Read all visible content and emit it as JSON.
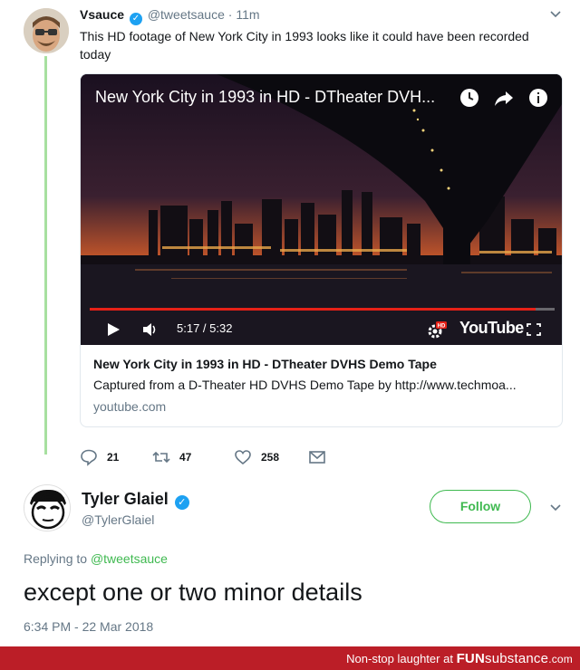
{
  "tweet1": {
    "name": "Vsauce",
    "handle": "@tweetsauce",
    "time": "· 11m",
    "text": "This HD footage of New York City in 1993 looks like it could have been recorded today",
    "video": {
      "title": "New York City in 1993 in HD - DTheater DVH...",
      "time": "5:17 / 5:32",
      "progress": 0.96,
      "logo": "YouTube",
      "hd_badge": "HD"
    },
    "card": {
      "title": "New York City in 1993 in HD - DTheater DVHS Demo Tape",
      "description": "Captured from a D-Theater HD DVHS Demo Tape by http://www.techmoa...",
      "domain": "youtube.com"
    },
    "actions": {
      "replies": "21",
      "retweets": "47",
      "likes": "258"
    }
  },
  "tweet2": {
    "name": "Tyler Glaiel",
    "handle": "@TylerGlaiel",
    "follow_label": "Follow",
    "replying_label": "Replying to",
    "replying_mention": "@tweetsauce",
    "text": "except one or two minor details",
    "time": "6:34 PM - 22 Mar 2018"
  },
  "footer": {
    "text": "Non-stop laughter at",
    "brand_bold": "FUN",
    "brand_thin": "substance",
    "brand_suffix": ".com"
  },
  "colors": {
    "accent": "#3fb950",
    "verified": "#1da1f2",
    "footer": "#bb1e27",
    "progress": "#e62117"
  }
}
